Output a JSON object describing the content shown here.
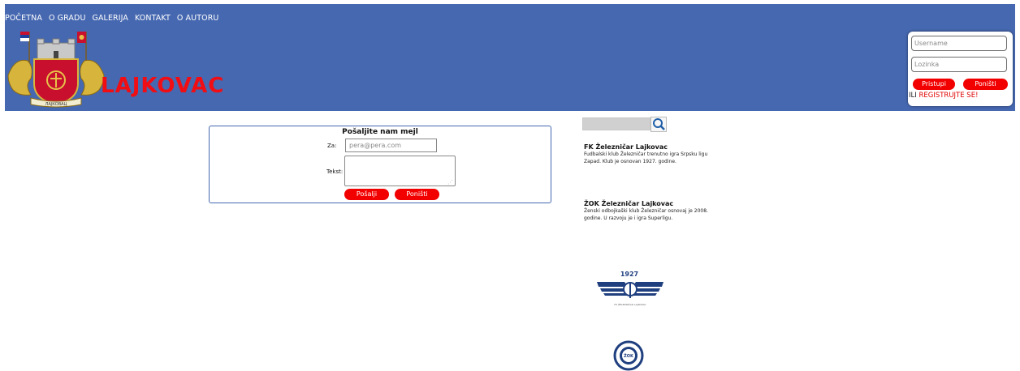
{
  "nav": {
    "items": [
      "POČETNA",
      "O GRADU",
      "GALERIJA",
      "KONTAKT",
      "O AUTORU"
    ]
  },
  "header": {
    "city_title": "LAJKOVAC",
    "crest_caption": "ЛАЈКОВАЦ",
    "background_color": "#4668b0",
    "title_color": "#f00e14"
  },
  "login": {
    "username_placeholder": "Username",
    "password_placeholder": "Lozinka",
    "submit_label": "Pristupi",
    "reset_label": "Poništi",
    "or_text": "ILI",
    "register_label": "REGISTRUJTE SE!",
    "button_color": "#f20000"
  },
  "mail_form": {
    "title": "Pošaljite nam mejl",
    "to_label": "Za:",
    "to_placeholder": "pera@pera.com",
    "text_label": "Tekst:",
    "send_label": "Pošalji",
    "reset_label": "Poništi"
  },
  "search": {
    "icon": "magnifier-icon"
  },
  "clubs": [
    {
      "title": "FK Železničar Lajkovac",
      "text": "Fudbalski klub Železničar trenutno igra Srpsku ligu Zapad. Klub je osnovan 1927. godine.",
      "logo_year": "1927",
      "logo_caption": "FK ŽELEZNIČAR LAJKOVAC"
    },
    {
      "title": "ŽOK Železničar Lajkovac",
      "text": "Ženski odbojkaški klub Železničar osnovaj je 2008. godine. U razvoju je i igra Superligu.",
      "logo_caption": "ŽOK"
    }
  ]
}
